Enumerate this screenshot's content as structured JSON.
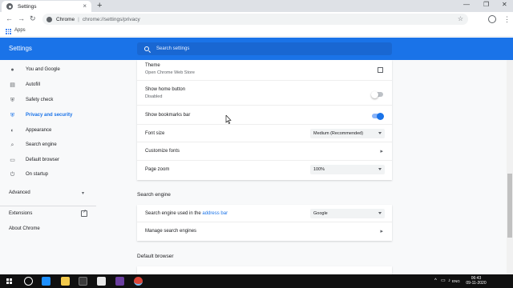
{
  "browser": {
    "tab_title": "Settings",
    "new_tab": "+",
    "tab_close": "×",
    "window_controls": [
      "—",
      "❐",
      "✕"
    ],
    "site_name": "Chrome",
    "separator": "|",
    "url": "chrome://settings/privacy",
    "star": "☆",
    "menu": "⋮",
    "nav": {
      "back": "←",
      "forward": "→",
      "reload": "↻"
    },
    "bookmarks": {
      "apps_label": "Apps"
    }
  },
  "header": {
    "title": "Settings",
    "search_placeholder": "Search settings"
  },
  "sidebar": {
    "items": [
      {
        "label": "You and Google",
        "icon": "person-icon",
        "glyph": "●"
      },
      {
        "label": "Autofill",
        "icon": "clipboard-icon",
        "glyph": "▤"
      },
      {
        "label": "Safety check",
        "icon": "shield-check-icon",
        "glyph": "⛨"
      },
      {
        "label": "Privacy and security",
        "icon": "shield-icon",
        "glyph": "⛨",
        "active": true
      },
      {
        "label": "Appearance",
        "icon": "palette-icon",
        "glyph": "◐"
      },
      {
        "label": "Search engine",
        "icon": "search-icon",
        "glyph": "⌕"
      },
      {
        "label": "Default browser",
        "icon": "browser-icon",
        "glyph": "▭"
      },
      {
        "label": "On startup",
        "icon": "power-icon",
        "glyph": "⏻"
      }
    ],
    "advanced": "Advanced",
    "caret": "▾",
    "extensions": "Extensions",
    "about": "About Chrome"
  },
  "appearance": {
    "theme_title": "Theme",
    "theme_sub": "Open Chrome Web Store",
    "home_title": "Show home button",
    "home_sub": "Disabled",
    "home_enabled": false,
    "bookmarks_title": "Show bookmarks bar",
    "bookmarks_enabled": true,
    "font_size_title": "Font size",
    "font_size_value": "Medium (Recommended)",
    "customize_fonts": "Customize fonts",
    "zoom_title": "Page zoom",
    "zoom_value": "100%",
    "chevron": "▸"
  },
  "search_engine": {
    "section_title": "Search engine",
    "used_prefix": "Search engine used in the ",
    "used_link": "address bar",
    "engine_value": "Google",
    "manage": "Manage search engines"
  },
  "default_browser": {
    "section_title": "Default browser"
  },
  "taskbar": {
    "time": "06:43",
    "date": "09-11-2020",
    "tray": [
      "^",
      "▭",
      "♪",
      "ENG"
    ]
  },
  "colors": {
    "accent": "#1a73e8",
    "header_bg": "#1a73e8",
    "page_bg": "#f8f9fa",
    "taskbar_bg": "#101010"
  }
}
